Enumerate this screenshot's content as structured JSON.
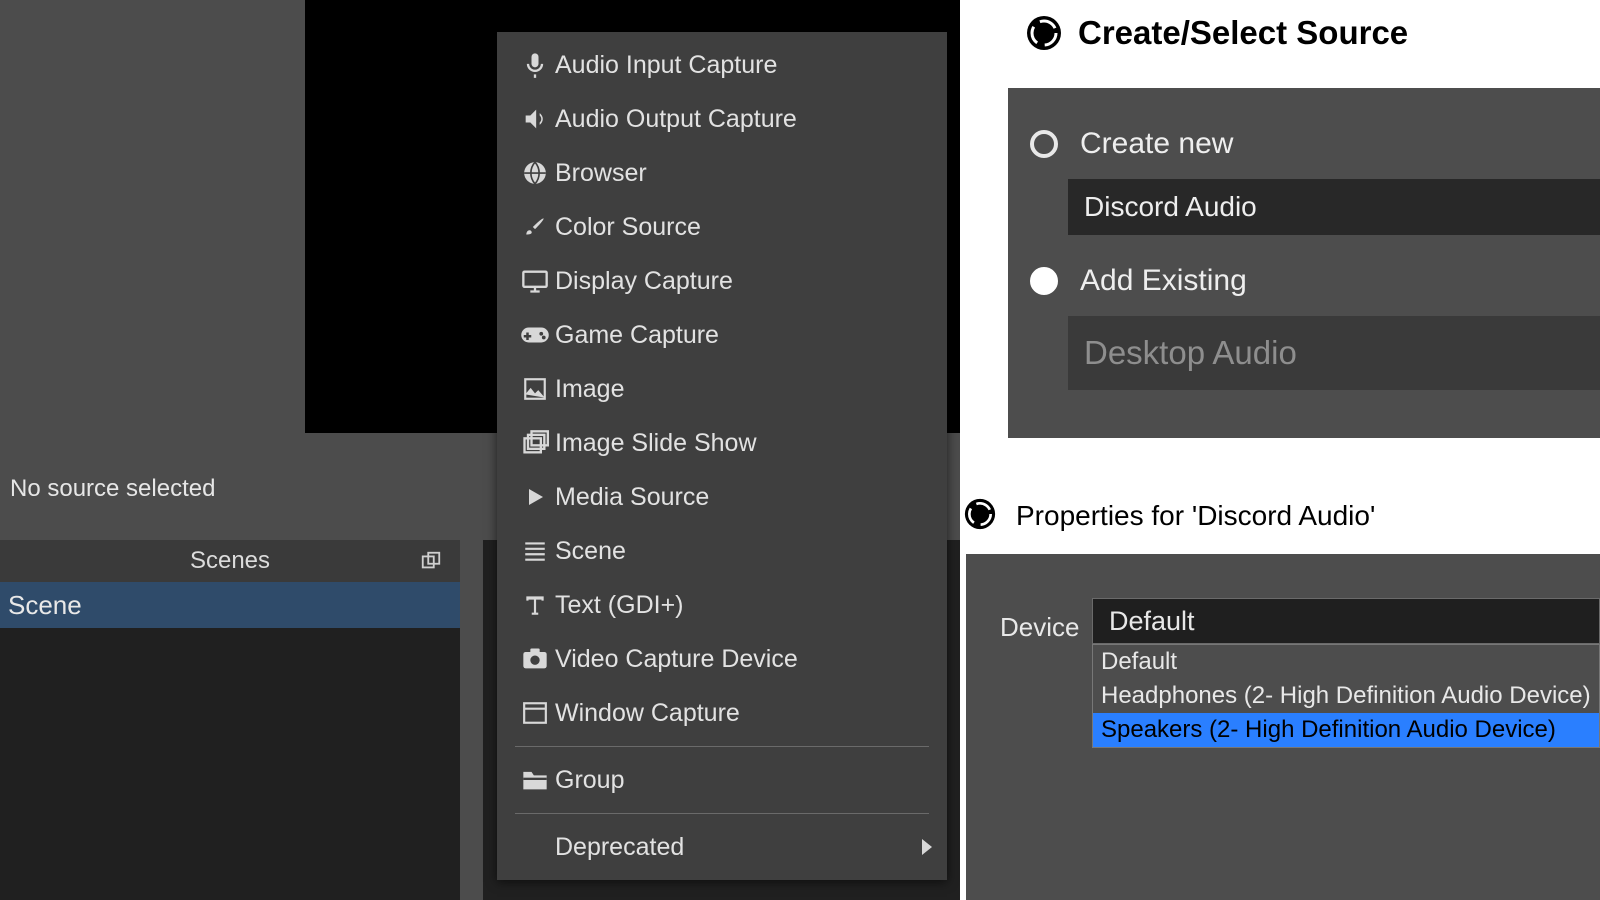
{
  "left": {
    "no_source": "No source selected",
    "scenes_header": "Scenes",
    "scene_items": [
      "Scene"
    ]
  },
  "context_menu": {
    "items": [
      "Audio Input Capture",
      "Audio Output Capture",
      "Browser",
      "Color Source",
      "Display Capture",
      "Game Capture",
      "Image",
      "Image Slide Show",
      "Media Source",
      "Scene",
      "Text (GDI+)",
      "Video Capture Device",
      "Window Capture"
    ],
    "group_label": "Group",
    "deprecated_label": "Deprecated"
  },
  "create_dialog": {
    "title": "Create/Select Source",
    "create_new_label": "Create new",
    "new_name": "Discord Audio",
    "add_existing_label": "Add Existing",
    "existing_item": "Desktop Audio"
  },
  "props_dialog": {
    "title": "Properties for 'Discord Audio'",
    "device_label": "Device",
    "selected": "Default",
    "options": [
      "Default",
      "Headphones (2- High Definition Audio Device)",
      "Speakers (2- High Definition Audio Device)"
    ],
    "highlighted_index": 2
  }
}
